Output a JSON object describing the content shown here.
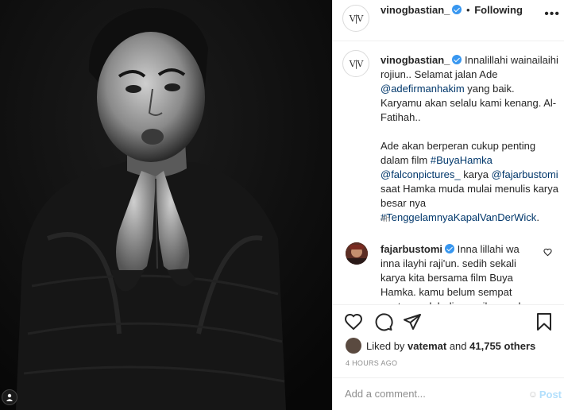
{
  "header": {
    "username": "vinogbastian_",
    "separator": "•",
    "follow_status": "Following",
    "more_label": "•••"
  },
  "avatar": {
    "logo_text": "V|V"
  },
  "caption": {
    "username": "vinogbastian_",
    "p1_a": "Innalillahi wainailaihi rojiun.. Selamat jalan Ade ",
    "p1_mention": "@adefirmanhakim",
    "p1_b": " yang baik. Karyamu akan selalu kami kenang. Al-Fatihah..",
    "p2_a": "Ade akan berperan cukup penting dalam film ",
    "p2_tag1": "#BuyaHamka",
    "p2_mention1": "@falconpictures_",
    "p2_b": " karya ",
    "p2_mention2": "@fajarbustomi",
    "p2_c": " saat Hamka muda mulai menulis karya besar nya ",
    "p2_tag2": "#TenggelamnyaKapalVanDerWick",
    "p2_d": ".",
    "age": "4h"
  },
  "comment": {
    "username": "fajarbustomi",
    "text": "Inna lillahi wa inna ilayhi raji'un. sedih sekali karya kita bersama film Buya Hamka. kamu belum sempat nonton sudah dipanggil yg maha"
  },
  "likes": {
    "prefix": "Liked by",
    "user": "vatemat",
    "and": "and",
    "others": "41,755 others"
  },
  "timestamp": "4 HOURS AGO",
  "add_comment": {
    "placeholder": "Add a comment...",
    "post_label": "Post",
    "emoji_icon": "☺"
  },
  "colors": {
    "verified": "#3897f0",
    "link": "#00376b",
    "post_disabled": "#b2dffc"
  },
  "icons": [
    "heart-icon",
    "comment-icon",
    "share-icon",
    "bookmark-icon",
    "more-options-icon",
    "verified-icon",
    "user-tag-icon",
    "emoji-icon"
  ]
}
